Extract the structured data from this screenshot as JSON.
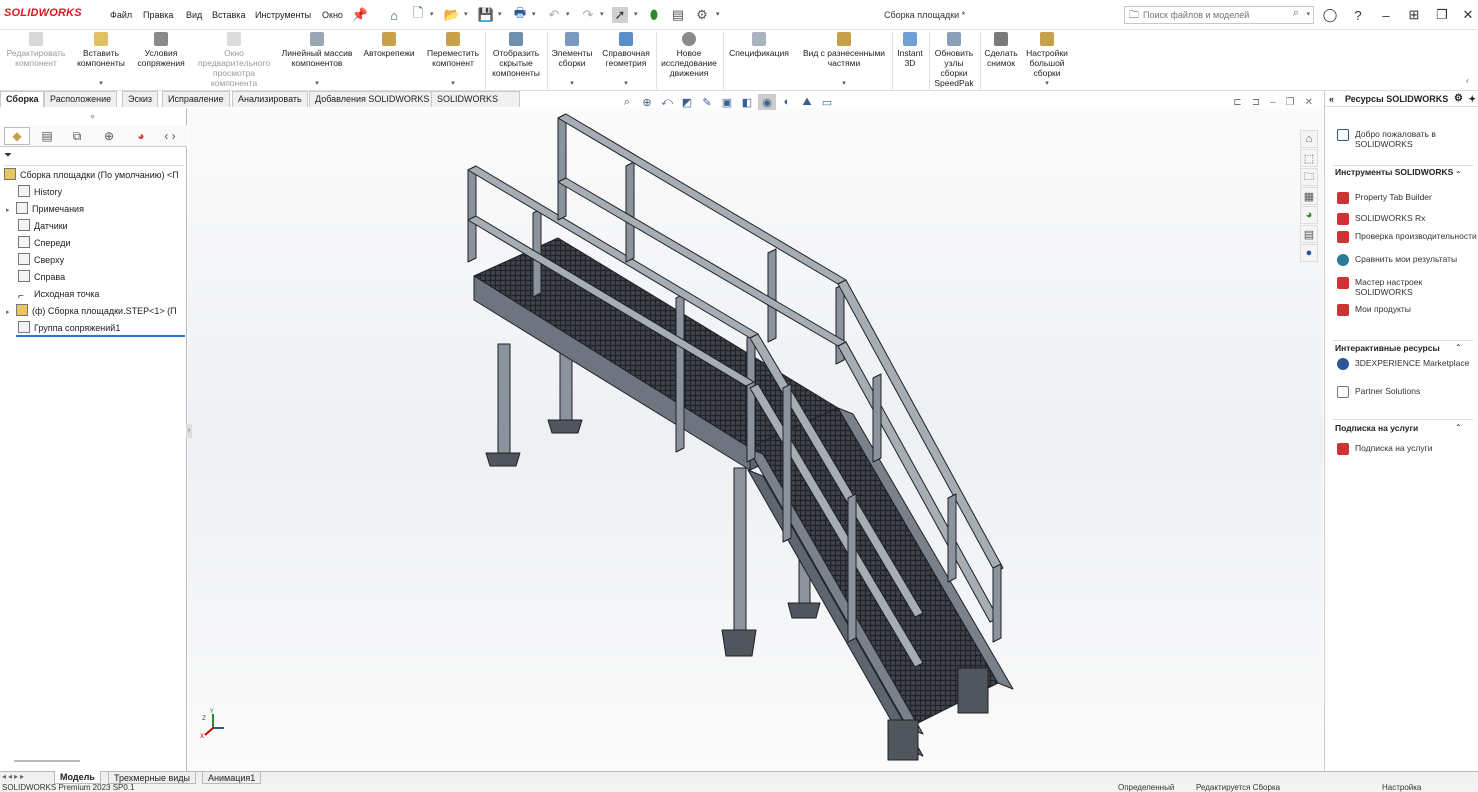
{
  "app": {
    "logo": "SOLIDWORKS",
    "document_title": "Сборка площадки *"
  },
  "menu": [
    "Файл",
    "Правка",
    "Вид",
    "Вставка",
    "Инструменты",
    "Окно"
  ],
  "search": {
    "placeholder": "Поиск файлов и моделей"
  },
  "ribbon": [
    {
      "label": "Редактировать\nкомпонент",
      "disabled": true
    },
    {
      "label": "Вставить\nкомпоненты",
      "disabled": false
    },
    {
      "label": "Условия\nсопряжения",
      "disabled": false
    },
    {
      "label": "Окно\nпредварительного\nпросмотра\nкомпонента",
      "disabled": true
    },
    {
      "label": "Линейный массив\nкомпонентов",
      "disabled": false
    },
    {
      "label": "Автокрепежи",
      "disabled": false
    },
    {
      "label": "Переместить\nкомпонент",
      "disabled": false
    },
    {
      "label": "Отобразить\nскрытые\nкомпоненты",
      "disabled": false
    },
    {
      "label": "Элементы\nсборки",
      "disabled": false
    },
    {
      "label": "Справочная\nгеометрия",
      "disabled": false
    },
    {
      "label": "Новое\nисследование\nдвижения",
      "disabled": false
    },
    {
      "label": "Спецификация",
      "disabled": false
    },
    {
      "label": "Вид с разнесенными\nчастями",
      "disabled": false
    },
    {
      "label": "Instant\n3D",
      "disabled": false
    },
    {
      "label": "Обновить\nузлы\nсборки\nSpeedPak",
      "disabled": false
    },
    {
      "label": "Сделать\nснимок",
      "disabled": false
    },
    {
      "label": "Настройки\nбольшой\nсборки",
      "disabled": false
    }
  ],
  "tabs": [
    "Сборка",
    "Расположение",
    "Эскиз",
    "Исправление",
    "Анализировать",
    "Добавления SOLIDWORKS",
    "SOLIDWORKS CAM"
  ],
  "tree": [
    {
      "label": "Сборка площадки (По умолчанию) <П",
      "icon": "assembly-icon"
    },
    {
      "label": "History",
      "icon": "history-icon"
    },
    {
      "label": "Примечания",
      "icon": "annotations-icon"
    },
    {
      "label": "Датчики",
      "icon": "sensor-icon"
    },
    {
      "label": "Спереди",
      "icon": "plane-icon"
    },
    {
      "label": "Сверху",
      "icon": "plane-icon"
    },
    {
      "label": "Справа",
      "icon": "plane-icon"
    },
    {
      "label": "Исходная точка",
      "icon": "origin-icon"
    },
    {
      "label": "(ф) Сборка площадки.STEP<1> (П",
      "icon": "subassembly-icon"
    },
    {
      "label": "Группа сопряжений1",
      "icon": "mates-icon"
    }
  ],
  "right_pane": {
    "title": "Ресурсы SOLIDWORKS",
    "welcome": "Добро пожаловать в SOLIDWORKS",
    "sec_tools": "Инструменты SOLIDWORKS",
    "tools": [
      "Property Tab Builder",
      "SOLIDWORKS Rx",
      "Проверка производительности",
      "Сравнить мои результаты",
      "Мастер настроек SOLIDWORKS",
      "Мои продукты"
    ],
    "sec_online": "Интерактивные ресурсы",
    "online": [
      "3DEXPERIENCE Marketplace",
      "Partner Solutions"
    ],
    "sec_sub": "Подписка на услуги",
    "sub": [
      "Подписка на услуги"
    ]
  },
  "bottom_tabs": [
    "Модель",
    "Трехмерные виды",
    "Анимация1"
  ],
  "status": {
    "left": "SOLIDWORKS Premium 2023 SP0.1",
    "state": "Определенный",
    "editing": "Редактируется Сборка",
    "settings": "Настройка"
  },
  "colors": {
    "brand": "#d71920",
    "accent": "#2b5797"
  }
}
